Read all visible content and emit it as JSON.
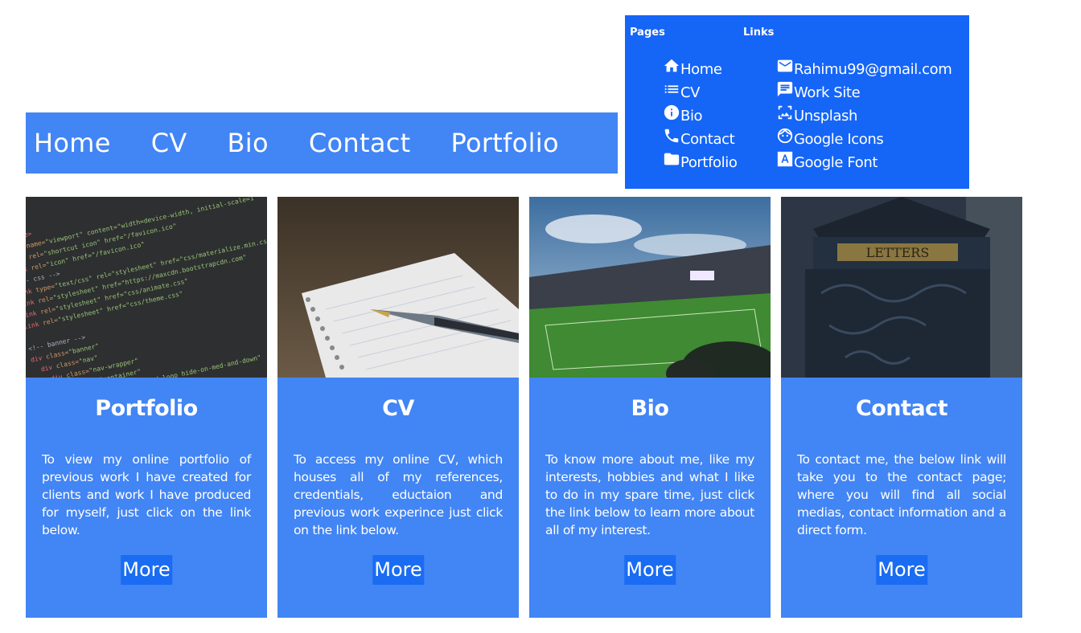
{
  "nav": [
    "Home",
    "CV",
    "Bio",
    "Contact",
    "Portfolio"
  ],
  "footer": {
    "pages_heading": "Pages",
    "links_heading": "Links",
    "pages": [
      {
        "icon": "home-icon",
        "label": "Home"
      },
      {
        "icon": "list-icon",
        "label": "CV"
      },
      {
        "icon": "info-icon",
        "label": "Bio"
      },
      {
        "icon": "phone-icon",
        "label": "Contact"
      },
      {
        "icon": "folder-icon",
        "label": "Portfolio"
      }
    ],
    "links": [
      {
        "icon": "mail-icon",
        "label": "Rahimu99@gmail.com"
      },
      {
        "icon": "chat-icon",
        "label": "Work Site"
      },
      {
        "icon": "image-search-icon",
        "label": "Unsplash"
      },
      {
        "icon": "face-icon",
        "label": "Google Icons"
      },
      {
        "icon": "font-icon",
        "label": "Google Font"
      }
    ]
  },
  "cards": [
    {
      "image": "code-editor-photo",
      "title": "Portfolio",
      "text": "To view my online portfolio of previous work I have created for clients and work I have produced for myself, just click on the link below.",
      "button": "More"
    },
    {
      "image": "notebook-pen-photo",
      "title": "CV",
      "text": "To access my online CV, which houses all of my references, credentials, eductaion and previous work experince just click on the link below.",
      "button": "More"
    },
    {
      "image": "football-stadium-photo",
      "title": "Bio",
      "text": "To know more about me, like my interests, hobbies and what I like to do in my spare time, just click the link below to learn more about all of my interest.",
      "button": "More"
    },
    {
      "image": "letterbox-photo",
      "title": "Contact",
      "text": "To contact me, the below link will take you to the contact page; where you will find all social medias, contact information and a direct form.",
      "button": "More"
    }
  ],
  "colors": {
    "nav_bg": "#4285f4",
    "footer_bg": "#1565f7",
    "card_bg": "#4285f4",
    "button_bg": "#1a6cf2"
  }
}
